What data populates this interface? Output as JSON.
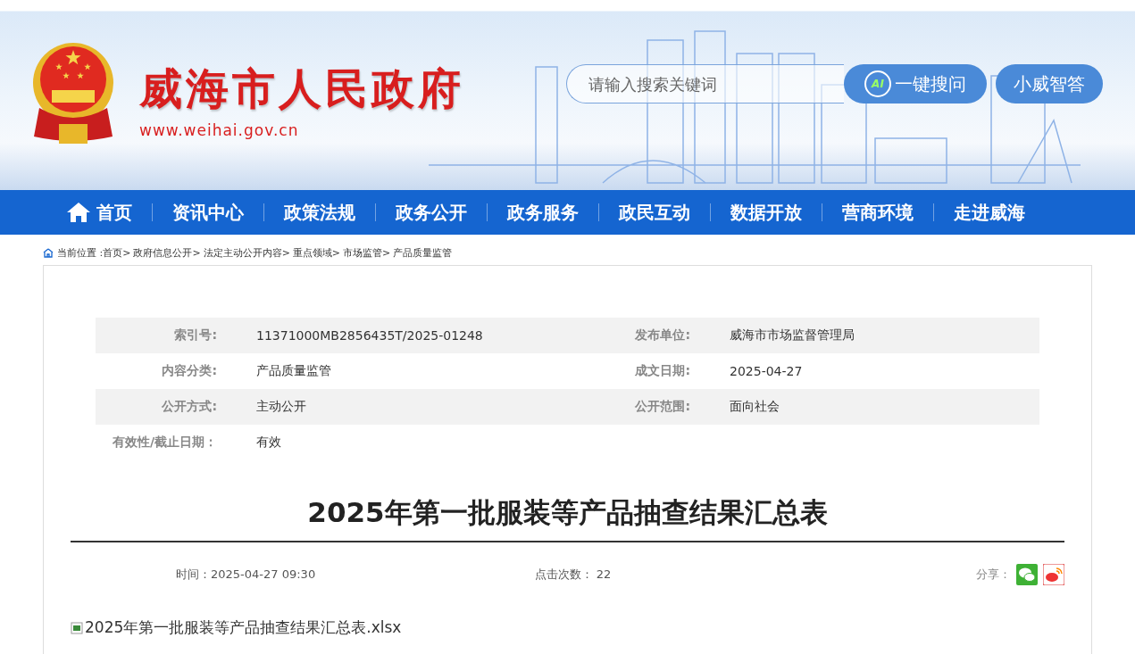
{
  "header": {
    "site_title": "威海市人民政府",
    "site_url": "www.weihai.gov.cn",
    "search": {
      "placeholder": "请输入搜索关键词"
    },
    "ai_button": {
      "badge": "AI",
      "label": "一键搜问"
    },
    "assistant_button": "小威智答"
  },
  "nav": [
    {
      "label": "首页",
      "kind": "home"
    },
    {
      "label": "资讯中心",
      "kind": "plain"
    },
    {
      "label": "政策法规",
      "kind": "plain"
    },
    {
      "label": "政务公开",
      "kind": "plain"
    },
    {
      "label": "政务服务",
      "kind": "plain"
    },
    {
      "label": "政民互动",
      "kind": "plain"
    },
    {
      "label": "数据开放",
      "kind": "plain"
    },
    {
      "label": "营商环境",
      "kind": "plain"
    },
    {
      "label": "走进威海",
      "kind": "plain"
    }
  ],
  "breadcrumb": {
    "label": "当前位置 :",
    "separator": ">",
    "items": [
      "首页",
      "政府信息公开",
      "法定主动公开内容",
      "重点领域",
      "市场监管",
      "产品质量监管"
    ]
  },
  "info_table": [
    [
      {
        "label": "索引号:",
        "value": "11371000MB2856435T/2025-01248"
      },
      {
        "label": "发布单位:",
        "value": "威海市市场监督管理局"
      }
    ],
    [
      {
        "label": "内容分类:",
        "value": "产品质量监管"
      },
      {
        "label": "成文日期:",
        "value": "2025-04-27"
      }
    ],
    [
      {
        "label": "公开方式:",
        "value": "主动公开"
      },
      {
        "label": "公开范围:",
        "value": "面向社会"
      }
    ],
    [
      {
        "label": "有效性/截止日期：",
        "value": "有效"
      }
    ]
  ],
  "article": {
    "title": "2025年第一批服装等产品抽查结果汇总表",
    "time": "时间：2025-04-27 09:30",
    "views_label": "点击次数：",
    "views": "22",
    "share_label": "分享：",
    "attachment": "2025年第一批服装等产品抽查结果汇总表.xlsx"
  }
}
